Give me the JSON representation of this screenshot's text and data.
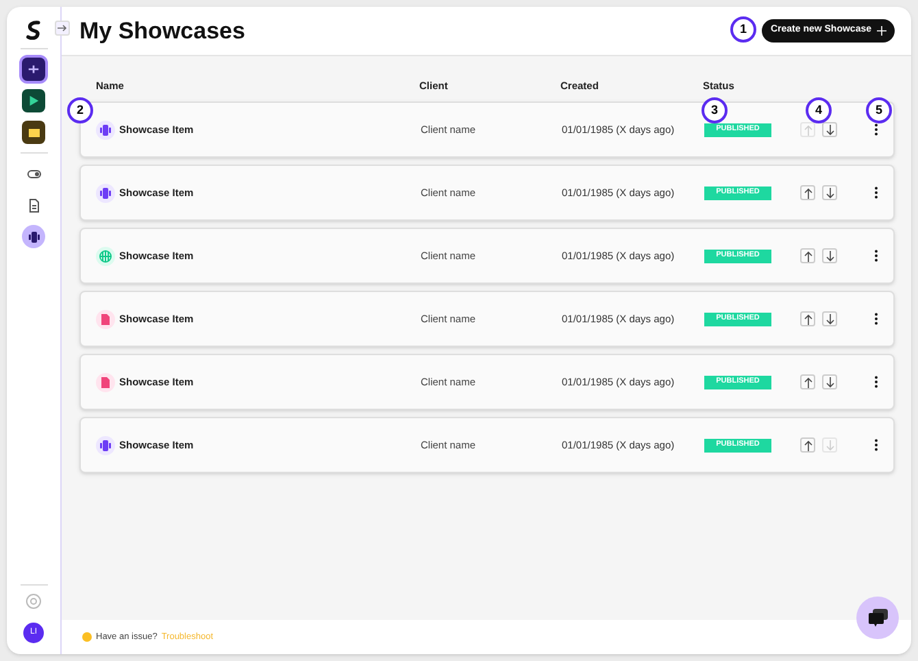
{
  "page": {
    "title": "My Showcases"
  },
  "create_button": {
    "label": "Create new Showcase"
  },
  "sidebar": {
    "items": [
      {
        "kind": "app-purple",
        "selected": true
      },
      {
        "kind": "app-green",
        "selected": false
      },
      {
        "kind": "app-amber",
        "selected": false
      },
      {
        "kind": "toggle",
        "selected": false
      },
      {
        "kind": "doc",
        "selected": false
      },
      {
        "kind": "audio",
        "selected": true
      }
    ],
    "avatar": "LI"
  },
  "table": {
    "columns": [
      "Name",
      "Client",
      "Created",
      "Status"
    ],
    "rows": [
      {
        "kind": "audio",
        "name": "Showcase Item",
        "client": "Client name",
        "created": "01/01/1985 (X days ago)",
        "status": "PUBLISHED",
        "up_disabled": true,
        "down_disabled": false
      },
      {
        "kind": "audio",
        "name": "Showcase Item",
        "client": "Client name",
        "created": "01/01/1985 (X days ago)",
        "status": "PUBLISHED",
        "up_disabled": false,
        "down_disabled": false
      },
      {
        "kind": "web",
        "name": "Showcase Item",
        "client": "Client name",
        "created": "01/01/1985 (X days ago)",
        "status": "PUBLISHED",
        "up_disabled": false,
        "down_disabled": false
      },
      {
        "kind": "doc",
        "name": "Showcase Item",
        "client": "Client name",
        "created": "01/01/1985 (X days ago)",
        "status": "PUBLISHED",
        "up_disabled": false,
        "down_disabled": false
      },
      {
        "kind": "doc",
        "name": "Showcase Item",
        "client": "Client name",
        "created": "01/01/1985 (X days ago)",
        "status": "PUBLISHED",
        "up_disabled": false,
        "down_disabled": false
      },
      {
        "kind": "audio",
        "name": "Showcase Item",
        "client": "Client name",
        "created": "01/01/1985 (X days ago)",
        "status": "PUBLISHED",
        "up_disabled": false,
        "down_disabled": true
      }
    ]
  },
  "annotations": [
    {
      "label": "1"
    },
    {
      "label": "2"
    },
    {
      "label": "3"
    },
    {
      "label": "4"
    },
    {
      "label": "5"
    }
  ],
  "footer": {
    "text": "Have an issue?",
    "link": "Troubleshoot"
  }
}
